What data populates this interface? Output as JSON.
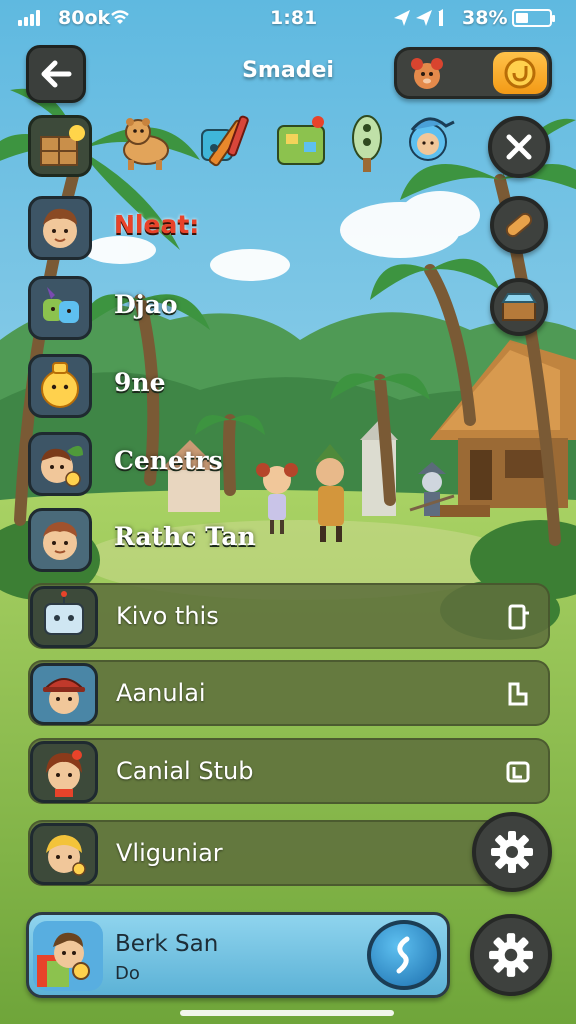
{
  "status_bar": {
    "carrier": "80ok",
    "time": "1:81",
    "battery_percent": "38%",
    "battery_level": 0.38
  },
  "header": {
    "title": "Smadei",
    "back_icon": "back-arrow-icon",
    "currency_icon": "coin-icon"
  },
  "top_icons": [
    "bear-toy-icon",
    "paint-tools-icon",
    "board-game-icon",
    "cactus-icon",
    "explorer-icon"
  ],
  "right_buttons": [
    "close-icon",
    "scroll-icon",
    "chest-icon"
  ],
  "left_items": [
    {
      "label": "",
      "icon": "crate-icon"
    },
    {
      "label": "Nleat:",
      "icon": "boy-avatar-icon"
    },
    {
      "label": "Djao",
      "icon": "plant-creature-icon"
    },
    {
      "label": "9ne",
      "icon": "yellow-creature-icon"
    },
    {
      "label": "Cenetrs",
      "icon": "leaf-avatar-icon"
    },
    {
      "label": "Rathc Tan",
      "icon": "boy-avatar-icon"
    }
  ],
  "bar_items": [
    {
      "label": "Kivo this",
      "icon": "robot-avatar-icon",
      "action_icon": "door-icon"
    },
    {
      "label": "Aanulai",
      "icon": "hat-avatar-icon",
      "action_icon": "tool-icon"
    },
    {
      "label": "Canial Stub",
      "icon": "girl-avatar-icon",
      "action_icon": "card-icon"
    },
    {
      "label": "Vliguniar",
      "icon": "blonde-avatar-icon",
      "action_icon": "gear-icon"
    }
  ],
  "profile": {
    "name": "Berk San",
    "subtitle": "Do"
  },
  "colors": {
    "sky": "#7fc6e4",
    "grass": "#8cc24e",
    "accent_red": "#e8432a",
    "coin": "#f5a623"
  }
}
